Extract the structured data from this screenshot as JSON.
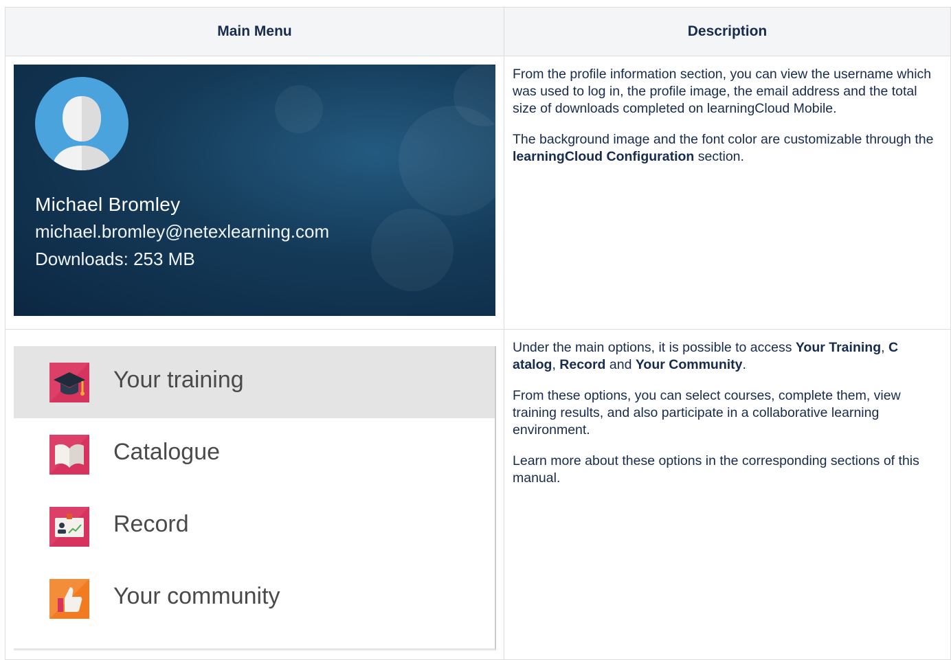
{
  "table": {
    "headers": {
      "menu": "Main Menu",
      "description": "Description"
    }
  },
  "profile": {
    "name": "Michael Bromley",
    "email": "michael.bromley@netexlearning.com",
    "downloads": "Downloads: 253 MB",
    "avatar_icon": "user-avatar-icon",
    "background_color": "#143a58",
    "avatar_color": "#4aa3dc"
  },
  "row1": {
    "p1": "From the profile information section, you can view the username which was used to log in, the profile image, the email address and the total size of downloads completed on learningCloud Mobile.",
    "p2_pre": "The background image and the font color are customizable through the ",
    "p2_bold": "learningCloud Configuration",
    "p2_post": " section."
  },
  "menu": {
    "items": [
      {
        "label": "Your training",
        "icon": "graduation-cap-icon",
        "color": "#d6335f",
        "active": true
      },
      {
        "label": "Catalogue",
        "icon": "book-icon",
        "color": "#d6335f",
        "active": false
      },
      {
        "label": "Record",
        "icon": "id-card-icon",
        "color": "#d6335f",
        "active": false
      },
      {
        "label": "Your community",
        "icon": "thumbs-up-icon",
        "color": "#f27b21",
        "active": false
      }
    ]
  },
  "row2": {
    "p1_pre": "Under the main options, it is possible to access ",
    "p1_b1": "Your Training",
    "p1_s1": ", ",
    "p1_b2": "C atalog",
    "p1_s2": ", ",
    "p1_b3": "Record",
    "p1_s3": " and ",
    "p1_b4": "Your Community",
    "p1_post": ".",
    "p2": "From these options, you can select courses, complete them, view training results, and also participate in a collaborative learning environment.",
    "p3": "Learn more about these options in the corresponding sections of this manual."
  }
}
